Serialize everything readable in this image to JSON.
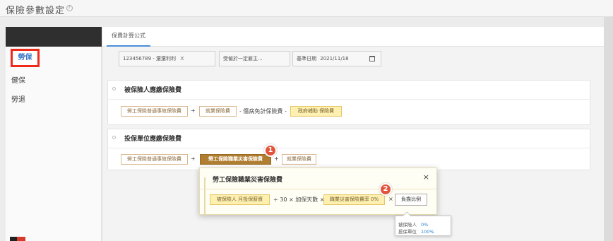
{
  "header": {
    "title": "保險參數設定",
    "help_icon": "question-circle-icon"
  },
  "sidebar": {
    "items": [
      {
        "label": "勞保",
        "active": true
      },
      {
        "label": "健保"
      },
      {
        "label": "勞退"
      }
    ]
  },
  "tabs": [
    {
      "label": "保費計算公式",
      "active": true
    }
  ],
  "filters": {
    "employee": "123456789 - 還還利利",
    "category": "受僱於一定雇主...",
    "base_date_label": "基準日期",
    "base_date": "2021/11/18",
    "clear_icon": "x",
    "calendar_icon": "calendar-icon"
  },
  "section_insured": {
    "title": "被保險人應繳保險費",
    "formula": [
      {
        "type": "chip",
        "label": "勞工保險普通事故保險費"
      },
      {
        "type": "op",
        "label": "+"
      },
      {
        "type": "chip",
        "label": "就業保險費"
      },
      {
        "type": "op",
        "label": "- 傷病免計保險費 -"
      },
      {
        "type": "chip-gold",
        "label": "政府補助 保險費"
      }
    ]
  },
  "section_employer": {
    "title": "投保單位應繳保險費",
    "formula": [
      {
        "type": "chip",
        "label": "勞工保險普通事故保險費"
      },
      {
        "type": "op",
        "label": "+"
      },
      {
        "type": "chip-dark",
        "label": "勞工保險職業災害保險費"
      },
      {
        "type": "op",
        "label": "+"
      },
      {
        "type": "chip",
        "label": "就業保險費"
      }
    ]
  },
  "badges": [
    "1",
    "2"
  ],
  "popup": {
    "title": "勞工保險職業災害保險費",
    "close": "×",
    "formula": [
      {
        "type": "chip-gold",
        "label": "被保險人 月投保薪資"
      },
      {
        "type": "op",
        "label": "÷ 30 × 加保天數 ×"
      },
      {
        "type": "chip-gold",
        "label": "職業災害保險費率 0%"
      },
      {
        "type": "op",
        "label": "×"
      },
      {
        "type": "chip-plain",
        "label": "負擔比例"
      }
    ]
  },
  "tooltip": {
    "rows": [
      {
        "label": "被保險人",
        "value": "0%"
      },
      {
        "label": "投保單位",
        "value": "100%"
      }
    ]
  },
  "colors": {
    "accent": "#4a90d9",
    "highlight_box": "#ee2a1a",
    "badge": "#e2543c",
    "chip_dark": "#b07e30",
    "chip_gold": "#fdf0b0"
  }
}
